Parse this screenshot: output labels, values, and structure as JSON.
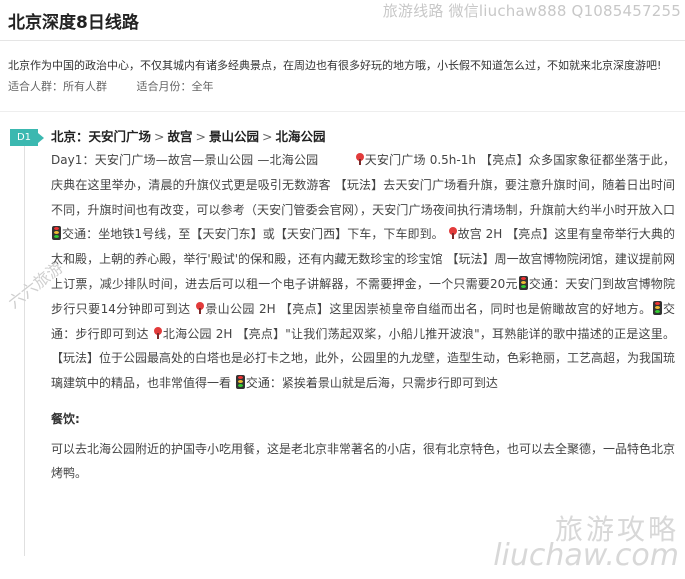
{
  "page": {
    "title": "北京深度8日线路",
    "watermark_top": "旅游线路 微信liuchaw888 Q1085457255",
    "intro": "北京作为中国的政治中心，不仅其城内有诸多经典景点，在周边也有很多好玩的地方哦，小长假不知道怎么过，不如就来北京深度游吧!",
    "fit_people_label": "适合人群：",
    "fit_people": "所有人群",
    "fit_month_label": "适合月份：",
    "fit_month": "全年"
  },
  "day1": {
    "badge": "D1",
    "route_prefix": "北京：",
    "stops": [
      "天安门广场",
      "故宫",
      "景山公园",
      "北海公园"
    ],
    "separator": ">",
    "p01": "Day1：天安门广场—故宫—景山公园 —北海公园",
    "p02": "天安门广场 0.5h-1h 【亮点】众多国家象征都坐落于此，庆典在这里举办，清晨的升旗仪式更是吸引无数游客 【玩法】去天安门广场看升旗，要注意升旗时间，随着日出时间不同，升旗时间也有改变，可以参考（天安门管委会官网），天安门广场夜间执行清场制，升旗前大约半小时开放入口",
    "p03": "交通：坐地铁1号线，至【天安门东】或【天安门西】下车，下车即到。",
    "p04": "故宫 2H 【亮点】这里有皇帝举行大典的太和殿，上朝的养心殿，举行'殿试'的保和殿，还有内藏无数珍宝的珍宝馆 【玩法】周一故宫博物院闭馆，建议提前网上订票，减少排队时间，进去后可以租一个电子讲解器，不需要押金，一个只需要20元",
    "p05": "交通：天安门到故宫博物院步行只要14分钟即可到达",
    "p06": "景山公园 2H 【亮点】这里因崇祯皇帝自缢而出名，同时也是俯瞰故宫的好地方。",
    "p07": "交通：步行即可到达",
    "p08": "北海公园 2H 【亮点】\"让我们荡起双桨，小船儿推开波浪\"，耳熟能详的歌中描述的正是这里。 【玩法】位于公园最高处的白塔也是必打卡之地，此外，公园里的九龙壁，造型生动，色彩艳丽，工艺高超，为我国琉璃建筑中的精品，也非常值得一看",
    "p09": "交通：紧挨着景山就是后海，只需步行即可到达",
    "meal_title": "餐饮:",
    "meal_text": "可以去北海公园附近的护国寺小吃用餐，这是老北京非常著名的小店，很有北京特色，也可以去全聚德，一品特色北京烤鸭。"
  },
  "watermarks": {
    "side": "六六旅游",
    "bottom_cn": "旅游攻略",
    "bottom_en": "liuchaw.com"
  },
  "colors": {
    "badge": "#3bb8b0",
    "pin": "#e23b3b"
  }
}
